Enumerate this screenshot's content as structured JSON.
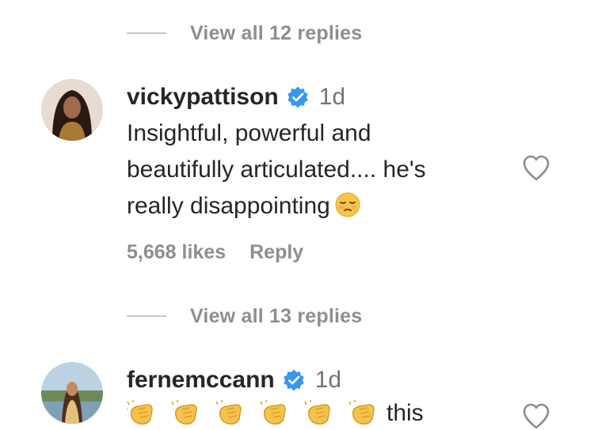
{
  "thread": {
    "view_replies_1": "View all 12 replies",
    "view_replies_2": "View all 13 replies"
  },
  "comments": [
    {
      "username": "vickypattison",
      "time": "1d",
      "text_lines": [
        "Insightful, powerful and",
        "beautifully articulated.... he's",
        "really disappointing"
      ],
      "emoji": "pensive-face-icon",
      "likes": "5,668 likes",
      "reply_label": "Reply"
    },
    {
      "username": "fernemccann",
      "time": "1d",
      "emoji": "clapping-hands-icon",
      "emoji_count": 6,
      "text": "this"
    }
  ],
  "colors": {
    "verified": "#3897f0",
    "muted": "#8e8e8e",
    "text": "#262626",
    "divider": "#c7c7c7"
  }
}
